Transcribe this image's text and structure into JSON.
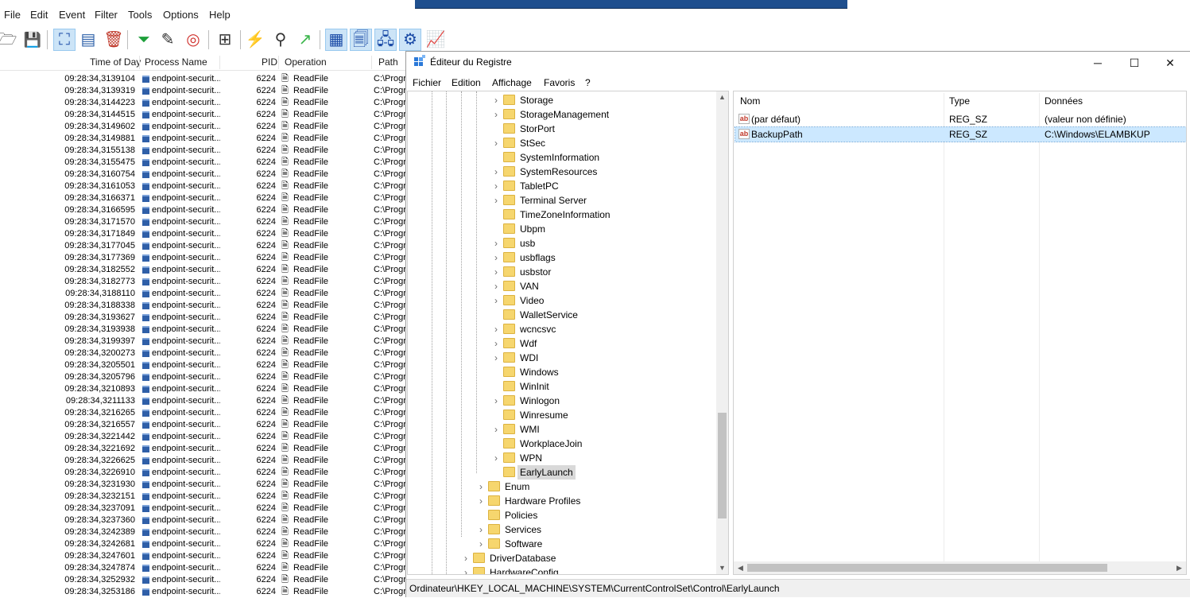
{
  "procmon": {
    "menu": [
      "File",
      "Edit",
      "Event",
      "Filter",
      "Tools",
      "Options",
      "Help"
    ],
    "toolbar_icons": [
      "open-icon",
      "save-icon",
      "capture-icon",
      "autoscroll-icon",
      "clear-icon",
      "filter-icon",
      "highlight-icon",
      "target-icon",
      "process-tree-icon",
      "event-properties-icon",
      "find-icon",
      "jump-icon",
      "show-registry-icon",
      "show-filesystem-icon",
      "show-network-icon",
      "show-process-icon",
      "show-profiling-icon"
    ],
    "columns": [
      "Time of Day",
      "Process Name",
      "PID",
      "Operation",
      "Path"
    ],
    "rows": [
      {
        "time": "09:28:34,3139104",
        "process": "endpoint-securit...",
        "pid": "6224",
        "op": "ReadFile",
        "path": "C:\\Progr"
      },
      {
        "time": "09:28:34,3139319",
        "process": "endpoint-securit...",
        "pid": "6224",
        "op": "ReadFile",
        "path": "C:\\Progr"
      },
      {
        "time": "09:28:34,3144223",
        "process": "endpoint-securit...",
        "pid": "6224",
        "op": "ReadFile",
        "path": "C:\\Progr"
      },
      {
        "time": "09:28:34,3144515",
        "process": "endpoint-securit...",
        "pid": "6224",
        "op": "ReadFile",
        "path": "C:\\Progr"
      },
      {
        "time": "09:28:34,3149602",
        "process": "endpoint-securit...",
        "pid": "6224",
        "op": "ReadFile",
        "path": "C:\\Progr"
      },
      {
        "time": "09:28:34,3149881",
        "process": "endpoint-securit...",
        "pid": "6224",
        "op": "ReadFile",
        "path": "C:\\Progr"
      },
      {
        "time": "09:28:34,3155138",
        "process": "endpoint-securit...",
        "pid": "6224",
        "op": "ReadFile",
        "path": "C:\\Progr"
      },
      {
        "time": "09:28:34,3155475",
        "process": "endpoint-securit...",
        "pid": "6224",
        "op": "ReadFile",
        "path": "C:\\Progr"
      },
      {
        "time": "09:28:34,3160754",
        "process": "endpoint-securit...",
        "pid": "6224",
        "op": "ReadFile",
        "path": "C:\\Progr"
      },
      {
        "time": "09:28:34,3161053",
        "process": "endpoint-securit...",
        "pid": "6224",
        "op": "ReadFile",
        "path": "C:\\Progr"
      },
      {
        "time": "09:28:34,3166371",
        "process": "endpoint-securit...",
        "pid": "6224",
        "op": "ReadFile",
        "path": "C:\\Progr"
      },
      {
        "time": "09:28:34,3166595",
        "process": "endpoint-securit...",
        "pid": "6224",
        "op": "ReadFile",
        "path": "C:\\Progr"
      },
      {
        "time": "09:28:34,3171570",
        "process": "endpoint-securit...",
        "pid": "6224",
        "op": "ReadFile",
        "path": "C:\\Progr"
      },
      {
        "time": "09:28:34,3171849",
        "process": "endpoint-securit...",
        "pid": "6224",
        "op": "ReadFile",
        "path": "C:\\Progr"
      },
      {
        "time": "09:28:34,3177045",
        "process": "endpoint-securit...",
        "pid": "6224",
        "op": "ReadFile",
        "path": "C:\\Progr"
      },
      {
        "time": "09:28:34,3177369",
        "process": "endpoint-securit...",
        "pid": "6224",
        "op": "ReadFile",
        "path": "C:\\Progr"
      },
      {
        "time": "09:28:34,3182552",
        "process": "endpoint-securit...",
        "pid": "6224",
        "op": "ReadFile",
        "path": "C:\\Progr"
      },
      {
        "time": "09:28:34,3182773",
        "process": "endpoint-securit...",
        "pid": "6224",
        "op": "ReadFile",
        "path": "C:\\Progr"
      },
      {
        "time": "09:28:34,3188110",
        "process": "endpoint-securit...",
        "pid": "6224",
        "op": "ReadFile",
        "path": "C:\\Progr"
      },
      {
        "time": "09:28:34,3188338",
        "process": "endpoint-securit...",
        "pid": "6224",
        "op": "ReadFile",
        "path": "C:\\Progr"
      },
      {
        "time": "09:28:34,3193627",
        "process": "endpoint-securit...",
        "pid": "6224",
        "op": "ReadFile",
        "path": "C:\\Progr"
      },
      {
        "time": "09:28:34,3193938",
        "process": "endpoint-securit...",
        "pid": "6224",
        "op": "ReadFile",
        "path": "C:\\Progr"
      },
      {
        "time": "09:28:34,3199397",
        "process": "endpoint-securit...",
        "pid": "6224",
        "op": "ReadFile",
        "path": "C:\\Progr"
      },
      {
        "time": "09:28:34,3200273",
        "process": "endpoint-securit...",
        "pid": "6224",
        "op": "ReadFile",
        "path": "C:\\Progr"
      },
      {
        "time": "09:28:34,3205501",
        "process": "endpoint-securit...",
        "pid": "6224",
        "op": "ReadFile",
        "path": "C:\\Progr"
      },
      {
        "time": "09:28:34,3205796",
        "process": "endpoint-securit...",
        "pid": "6224",
        "op": "ReadFile",
        "path": "C:\\Progr"
      },
      {
        "time": "09:28:34,3210893",
        "process": "endpoint-securit...",
        "pid": "6224",
        "op": "ReadFile",
        "path": "C:\\Progr"
      },
      {
        "time": "09:28:34,3211133",
        "process": "endpoint-securit...",
        "pid": "6224",
        "op": "ReadFile",
        "path": "C:\\Progr"
      },
      {
        "time": "09:28:34,3216265",
        "process": "endpoint-securit...",
        "pid": "6224",
        "op": "ReadFile",
        "path": "C:\\Progr"
      },
      {
        "time": "09:28:34,3216557",
        "process": "endpoint-securit...",
        "pid": "6224",
        "op": "ReadFile",
        "path": "C:\\Progr"
      },
      {
        "time": "09:28:34,3221442",
        "process": "endpoint-securit...",
        "pid": "6224",
        "op": "ReadFile",
        "path": "C:\\Progr"
      },
      {
        "time": "09:28:34,3221692",
        "process": "endpoint-securit...",
        "pid": "6224",
        "op": "ReadFile",
        "path": "C:\\Progr"
      },
      {
        "time": "09:28:34,3226625",
        "process": "endpoint-securit...",
        "pid": "6224",
        "op": "ReadFile",
        "path": "C:\\Progr"
      },
      {
        "time": "09:28:34,3226910",
        "process": "endpoint-securit...",
        "pid": "6224",
        "op": "ReadFile",
        "path": "C:\\Progr"
      },
      {
        "time": "09:28:34,3231930",
        "process": "endpoint-securit...",
        "pid": "6224",
        "op": "ReadFile",
        "path": "C:\\Progr"
      },
      {
        "time": "09:28:34,3232151",
        "process": "endpoint-securit...",
        "pid": "6224",
        "op": "ReadFile",
        "path": "C:\\Progr"
      },
      {
        "time": "09:28:34,3237091",
        "process": "endpoint-securit...",
        "pid": "6224",
        "op": "ReadFile",
        "path": "C:\\Progr"
      },
      {
        "time": "09:28:34,3237360",
        "process": "endpoint-securit...",
        "pid": "6224",
        "op": "ReadFile",
        "path": "C:\\Progr"
      },
      {
        "time": "09:28:34,3242389",
        "process": "endpoint-securit...",
        "pid": "6224",
        "op": "ReadFile",
        "path": "C:\\Progr"
      },
      {
        "time": "09:28:34,3242681",
        "process": "endpoint-securit...",
        "pid": "6224",
        "op": "ReadFile",
        "path": "C:\\Progr"
      },
      {
        "time": "09:28:34,3247601",
        "process": "endpoint-securit...",
        "pid": "6224",
        "op": "ReadFile",
        "path": "C:\\Progr"
      },
      {
        "time": "09:28:34,3247874",
        "process": "endpoint-securit...",
        "pid": "6224",
        "op": "ReadFile",
        "path": "C:\\Progr"
      },
      {
        "time": "09:28:34,3252932",
        "process": "endpoint-securit...",
        "pid": "6224",
        "op": "ReadFile",
        "path": "C:\\Progr"
      },
      {
        "time": "09:28:34,3253186",
        "process": "endpoint-securit...",
        "pid": "6224",
        "op": "ReadFile",
        "path": "C:\\Progr"
      }
    ]
  },
  "regedit": {
    "title": "Éditeur du Registre",
    "window_controls": {
      "minimize": "─",
      "maximize": "☐",
      "close": "✕"
    },
    "menu": [
      "Fichier",
      "Edition",
      "Affichage",
      "Favoris",
      "?"
    ],
    "tree": [
      {
        "label": "Storage",
        "expandable": true,
        "level": 4
      },
      {
        "label": "StorageManagement",
        "expandable": true,
        "level": 4
      },
      {
        "label": "StorPort",
        "expandable": false,
        "level": 4
      },
      {
        "label": "StSec",
        "expandable": true,
        "level": 4
      },
      {
        "label": "SystemInformation",
        "expandable": false,
        "level": 4
      },
      {
        "label": "SystemResources",
        "expandable": true,
        "level": 4
      },
      {
        "label": "TabletPC",
        "expandable": true,
        "level": 4
      },
      {
        "label": "Terminal Server",
        "expandable": true,
        "level": 4
      },
      {
        "label": "TimeZoneInformation",
        "expandable": false,
        "level": 4
      },
      {
        "label": "Ubpm",
        "expandable": false,
        "level": 4
      },
      {
        "label": "usb",
        "expandable": true,
        "level": 4
      },
      {
        "label": "usbflags",
        "expandable": true,
        "level": 4
      },
      {
        "label": "usbstor",
        "expandable": true,
        "level": 4
      },
      {
        "label": "VAN",
        "expandable": true,
        "level": 4
      },
      {
        "label": "Video",
        "expandable": true,
        "level": 4
      },
      {
        "label": "WalletService",
        "expandable": false,
        "level": 4
      },
      {
        "label": "wcncsvc",
        "expandable": true,
        "level": 4
      },
      {
        "label": "Wdf",
        "expandable": true,
        "level": 4
      },
      {
        "label": "WDI",
        "expandable": true,
        "level": 4
      },
      {
        "label": "Windows",
        "expandable": false,
        "level": 4
      },
      {
        "label": "WinInit",
        "expandable": false,
        "level": 4
      },
      {
        "label": "Winlogon",
        "expandable": true,
        "level": 4
      },
      {
        "label": "Winresume",
        "expandable": false,
        "level": 4
      },
      {
        "label": "WMI",
        "expandable": true,
        "level": 4
      },
      {
        "label": "WorkplaceJoin",
        "expandable": false,
        "level": 4
      },
      {
        "label": "WPN",
        "expandable": true,
        "level": 4
      },
      {
        "label": "EarlyLaunch",
        "expandable": false,
        "level": 4,
        "selected": true
      },
      {
        "label": "Enum",
        "expandable": true,
        "level": 3
      },
      {
        "label": "Hardware Profiles",
        "expandable": true,
        "level": 3
      },
      {
        "label": "Policies",
        "expandable": false,
        "level": 3
      },
      {
        "label": "Services",
        "expandable": true,
        "level": 3
      },
      {
        "label": "Software",
        "expandable": true,
        "level": 3
      },
      {
        "label": "DriverDatabase",
        "expandable": true,
        "level": 2
      },
      {
        "label": "HardwareConfig",
        "expandable": true,
        "level": 2
      }
    ],
    "list_columns": [
      "Nom",
      "Type",
      "Données"
    ],
    "values": [
      {
        "name": "(par défaut)",
        "type": "REG_SZ",
        "data": "(valeur non définie)",
        "selected": false
      },
      {
        "name": "BackupPath",
        "type": "REG_SZ",
        "data": "C:\\Windows\\ELAMBKUP",
        "selected": true
      }
    ],
    "status_path": "Ordinateur\\HKEY_LOCAL_MACHINE\\SYSTEM\\CurrentControlSet\\Control\\EarlyLaunch"
  }
}
